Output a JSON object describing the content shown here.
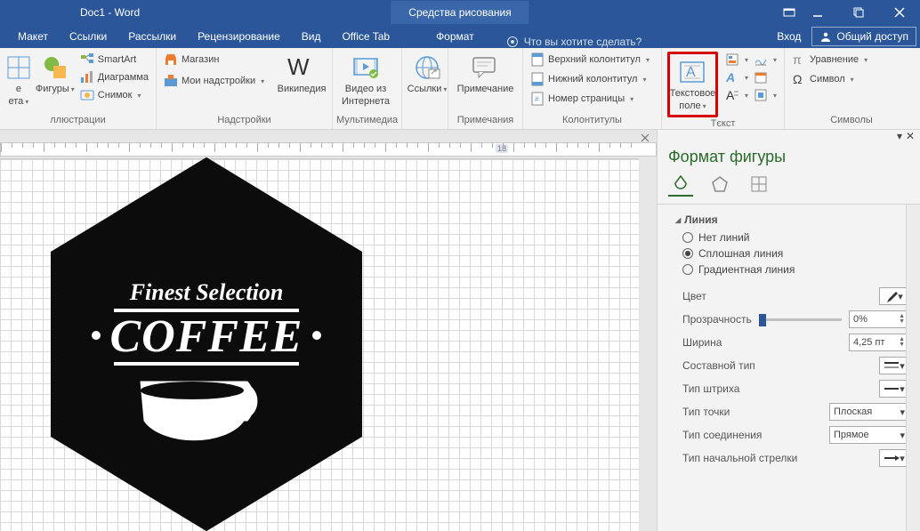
{
  "title": {
    "doc": "Doc1 - Word",
    "context_tab": "Средства рисования"
  },
  "tabs": {
    "maket": "Макет",
    "ssylki": "Ссылки",
    "rassylki": "Рассылки",
    "review": "Рецензирование",
    "view": "Вид",
    "officetab": "Office Tab",
    "format": "Формат"
  },
  "tellme": {
    "placeholder": "Что вы хотите сделать?"
  },
  "account": {
    "login": "Вход",
    "share": "Общий доступ"
  },
  "ribbon": {
    "illustrations": {
      "label": "ллюстрации",
      "shapes_line1": "е",
      "shapes_line2": "ета",
      "figures": "Фигуры",
      "smartart": "SmartArt",
      "chart": "Диаграмма",
      "screenshot": "Снимок"
    },
    "addins": {
      "label": "Надстройки",
      "store": "Магазин",
      "myaddins": "Мои надстройки",
      "wikipedia": "Википедия"
    },
    "media": {
      "label": "Мультимедиа",
      "video_l1": "Видео из",
      "video_l2": "Интернета"
    },
    "links": {
      "label": "",
      "links": "Ссылки"
    },
    "comments": {
      "label": "Примечания",
      "comment": "Примечание"
    },
    "headers": {
      "label": "Колонтитулы",
      "header": "Верхний колонтитул",
      "footer": "Нижний колонтитул",
      "pagenum": "Номер страницы"
    },
    "text": {
      "label": "Тєкст",
      "textbox_l1": "Текстовое",
      "textbox_l2": "поле"
    },
    "symbols": {
      "label": "Символы",
      "equation": "Уравнение",
      "symbol": "Символ"
    }
  },
  "ruler": {
    "mark": "18"
  },
  "logo": {
    "line1": "Finest Selection",
    "line2": "COFFEE"
  },
  "pane": {
    "title": "Формат фигуры",
    "section_line": "Линия",
    "opt_none": "Нет линий",
    "opt_solid": "Сплошная линия",
    "opt_grad": "Градиентная линия",
    "color": "Цвет",
    "transparency": "Прозрачность",
    "transparency_val": "0%",
    "width": "Ширина",
    "width_val": "4,25 пт",
    "compound": "Составной тип",
    "dash": "Тип штриха",
    "cap": "Тип точки",
    "cap_val": "Плоская",
    "join": "Тип соединения",
    "join_val": "Прямое",
    "begin_arrow": "Тип начальной стрелки"
  }
}
